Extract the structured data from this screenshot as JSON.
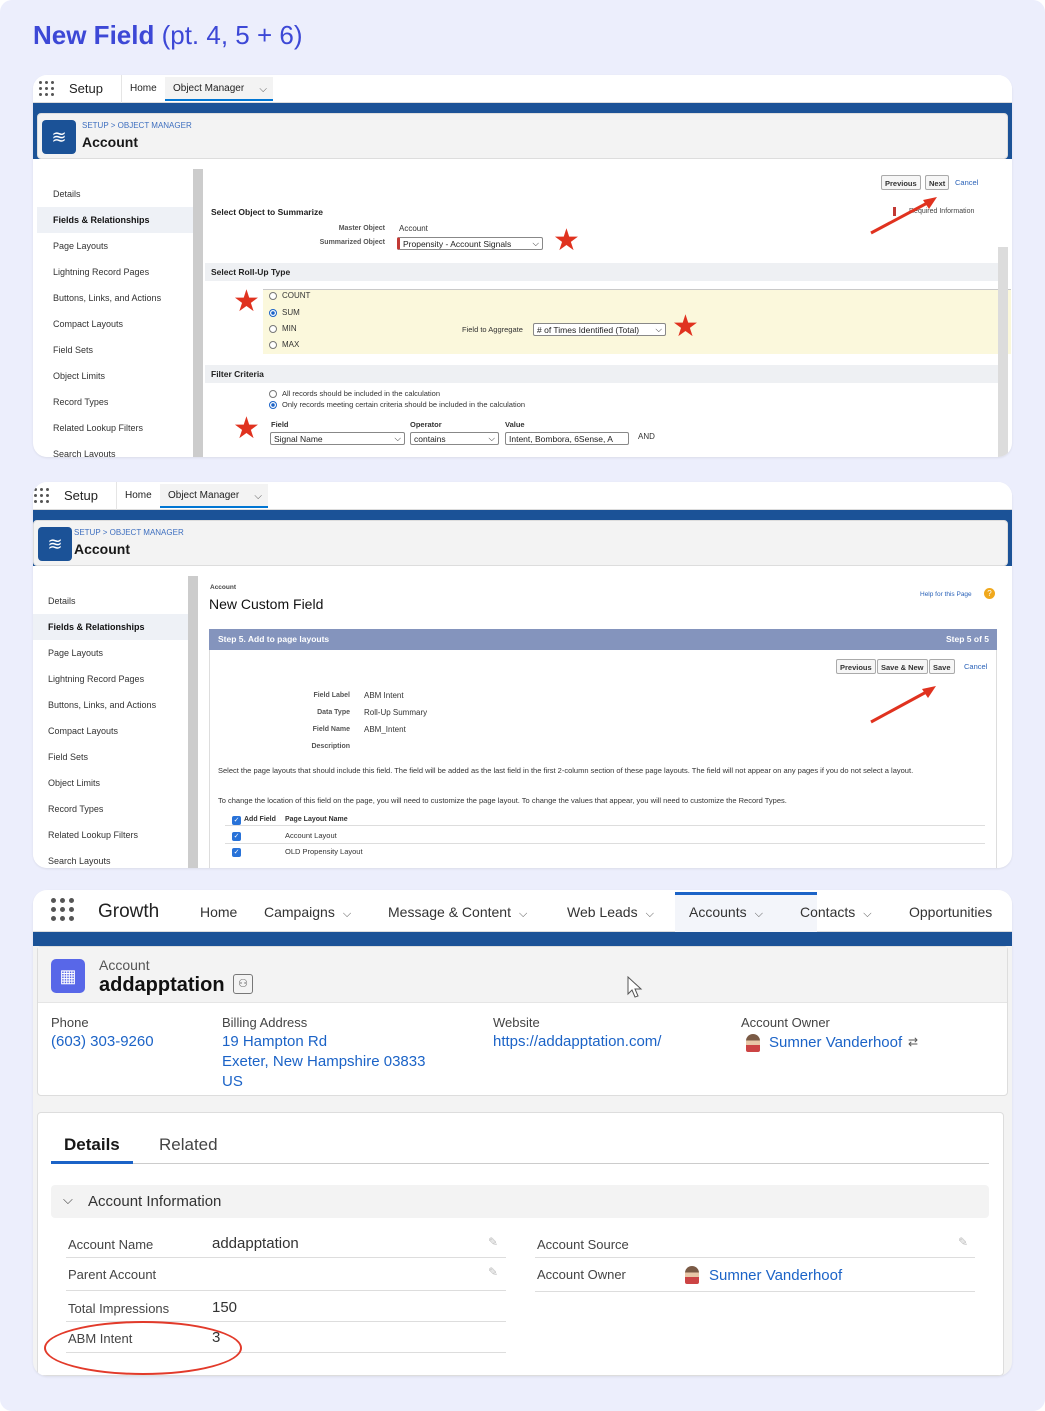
{
  "title": {
    "bold": "New Field",
    "sub": "(pt. 4, 5 + 6)"
  },
  "colors": {
    "accent": "#3d48d6",
    "sf_blue": "#1b5297",
    "link": "#1b63c7",
    "star": "#e0321f",
    "highlight": "#fbf8dc"
  },
  "setup_nav": {
    "app": "Setup",
    "home": "Home",
    "object_manager": "Object Manager",
    "breadcrumb": "SETUP > OBJECT MANAGER",
    "object": "Account",
    "icon": "layers-icon"
  },
  "sidebar": {
    "items": [
      "Details",
      "Fields & Relationships",
      "Page Layouts",
      "Lightning Record Pages",
      "Buttons, Links, and Actions",
      "Compact Layouts",
      "Field Sets",
      "Object Limits",
      "Record Types",
      "Related Lookup Filters",
      "Search Layouts"
    ],
    "active": "Fields & Relationships"
  },
  "shot1": {
    "buttons": {
      "previous": "Previous",
      "next": "Next",
      "cancel": "Cancel"
    },
    "required_info": "Required Information",
    "summarize": {
      "heading": "Select Object to Summarize",
      "master_label": "Master Object",
      "master_value": "Account",
      "summarized_label": "Summarized Object",
      "summarized_value": "Propensity - Account Signals"
    },
    "rollup": {
      "heading": "Select Roll-Up Type",
      "options": [
        "COUNT",
        "SUM",
        "MIN",
        "MAX"
      ],
      "selected": "SUM",
      "aggregate_label": "Field to Aggregate",
      "aggregate_value": "# of Times Identified (Total)"
    },
    "filter": {
      "heading": "Filter Criteria",
      "opt_all": "All records should be included in the calculation",
      "opt_some": "Only records meeting certain criteria should be included in the calculation",
      "col_field": "Field",
      "col_operator": "Operator",
      "col_value": "Value",
      "field": "Signal Name",
      "operator": "contains",
      "value": "Intent, Bombora, 6Sense, A",
      "logic": "AND"
    }
  },
  "shot2": {
    "object_small": "Account",
    "page_title": "New Custom Field",
    "help": "Help for this Page",
    "step_title": "Step 5. Add to page layouts",
    "step_count": "Step 5 of 5",
    "buttons": {
      "previous": "Previous",
      "save_new": "Save & New",
      "save": "Save",
      "cancel": "Cancel"
    },
    "fields": [
      {
        "label": "Field Label",
        "value": "ABM Intent"
      },
      {
        "label": "Data Type",
        "value": "Roll-Up Summary"
      },
      {
        "label": "Field Name",
        "value": "ABM_Intent"
      },
      {
        "label": "Description",
        "value": ""
      }
    ],
    "para1": "Select the page layouts that should include this field. The field will be added as the last field in the first 2-column section of these page layouts. The field will not appear on any pages if you do not select a layout.",
    "para2": "To change the location of this field on the page, you will need to customize the page layout. To change the values that appear, you will need to customize the Record Types.",
    "table": {
      "col_add": "Add Field",
      "col_name": "Page Layout Name",
      "rows": [
        "Account Layout",
        "OLD Propensity Layout"
      ]
    }
  },
  "shot3": {
    "app": "Growth",
    "nav": [
      "Home",
      "Campaigns",
      "Message & Content",
      "Web Leads",
      "Accounts",
      "Contacts",
      "Opportunities"
    ],
    "nav_active": "Accounts",
    "record": {
      "kind": "Account",
      "name": "addapptation",
      "icon": "building-icon"
    },
    "highlights": [
      {
        "label": "Phone",
        "value": "(603) 303-9260"
      },
      {
        "label": "Billing Address",
        "value": "19 Hampton Rd",
        "value2": "Exeter, New Hampshire 03833",
        "value3": "US"
      },
      {
        "label": "Website",
        "value": "https://addapptation.com/"
      },
      {
        "label": "Account Owner",
        "value": "Sumner Vanderhoof"
      }
    ],
    "tabs": [
      "Details",
      "Related"
    ],
    "section": "Account Information",
    "left_fields": [
      {
        "label": "Account Name",
        "value": "addapptation"
      },
      {
        "label": "Parent Account",
        "value": ""
      },
      {
        "label": "Total Impressions",
        "value": "150"
      },
      {
        "label": "ABM Intent",
        "value": "3"
      }
    ],
    "right_fields": [
      {
        "label": "Account Source",
        "value": ""
      },
      {
        "label": "Account Owner",
        "value": "Sumner Vanderhoof"
      }
    ]
  }
}
